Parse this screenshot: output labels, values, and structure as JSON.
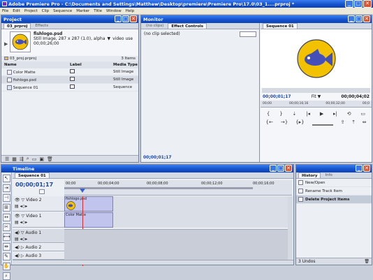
{
  "app": {
    "title": "Adobe Premiere Pro - C:\\Documents and Settings\\Matthew\\Desktop\\premiere\\Premiere Pro\\17.0\\03_1....prproj *"
  },
  "menu": [
    "File",
    "Edit",
    "Project",
    "Clip",
    "Sequence",
    "Marker",
    "Title",
    "Window",
    "Help"
  ],
  "project": {
    "title": "Project",
    "tabs": [
      "03_prproj",
      "Effects"
    ],
    "clip_name": "fishlogo.psd",
    "clip_info": "Still Image, 287 x 287 (1.0), alpha",
    "clip_info2": "video use",
    "clip_duration": "00;00;26;00",
    "bin_name": "03_proj.prproj",
    "item_count": "3 Items",
    "columns": [
      "Name",
      "Label",
      "Media Type"
    ],
    "items": [
      {
        "name": "Color Matte",
        "type": "Still Image"
      },
      {
        "name": "fishlogo.psd",
        "type": "Still Image"
      },
      {
        "name": "Sequence 01",
        "type": "Sequence"
      }
    ]
  },
  "monitor": {
    "title": "Monitor",
    "source_tabs": [
      "(no clips)",
      "Effect Controls"
    ],
    "no_clip": "(no clip selected)",
    "source_timecode": "00;00;01;17",
    "program_tab": "Sequence 01",
    "program_timecode": "00;00;01;17",
    "fit": "Fit",
    "program_duration": "00;00;04;02",
    "ruler_ticks": [
      "00;00",
      "00;00;16;16",
      "00;00;32;00",
      "00;0"
    ]
  },
  "timeline": {
    "title": "Timeline",
    "tab": "Sequence 01",
    "timecode": "00;00;01;17",
    "ticks": [
      "00;00",
      "00;00;04;00",
      "00;00;08;00",
      "00;00;12;00",
      "00;00;16;00"
    ],
    "video_tracks": [
      {
        "name": "Video 2",
        "clip": "fishlogo.psd"
      },
      {
        "name": "Video 1",
        "clip": "Color Matte"
      }
    ],
    "audio_tracks": [
      "Audio 1",
      "Audio 2",
      "Audio 3"
    ]
  },
  "history": {
    "tabs": [
      "History",
      "Info"
    ],
    "items": [
      "New/Open",
      "Rename Track Item",
      "Delete Project Items"
    ],
    "status": "3 Undos"
  }
}
